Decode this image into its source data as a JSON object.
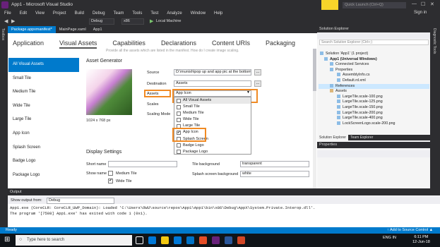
{
  "window": {
    "title": "App1 - Microsoft Visual Studio",
    "signin": "Sign in",
    "quick_launch_placeholder": "Quick Launch (Ctrl+Q)",
    "min": "—",
    "max": "☐",
    "close": "✕"
  },
  "menu": [
    "File",
    "Edit",
    "View",
    "Project",
    "Build",
    "Debug",
    "Team",
    "Tools",
    "Test",
    "Analyze",
    "Window",
    "Help"
  ],
  "toolbar": {
    "config": "Debug",
    "platform": "x86",
    "run_label": "Local Machine"
  },
  "toolbox_label": "Toolbox",
  "doc_tabs": [
    "Package.appxmanifest*",
    "MainPage.xaml",
    "App1"
  ],
  "manifest": {
    "tabs": [
      "Application",
      "Visual Assets",
      "Capabilities",
      "Declarations",
      "Content URIs",
      "Packaging"
    ],
    "hint": "Provide all the assets which are listed in the manifest. How do I create image scaling.",
    "nav": [
      "All Visual Assets",
      "Small Tile",
      "Medium Tile",
      "Wide Tile",
      "Large Tile",
      "App Icon",
      "Splash Screen",
      "Badge Logo",
      "Package Logo"
    ],
    "generator_title": "Asset Generator",
    "image_size": "1024 x 768 px",
    "source_label": "Source",
    "source_value": "D:\\munish\\pop up and app pic at the bottom",
    "destination_label": "Destination",
    "destination_value": "Assets",
    "assets_label": "Assets",
    "assets_value": "App Icon",
    "scales_label": "Scales",
    "scaling_mode_label": "Scaling Mode",
    "browse": "...",
    "dropdown": [
      {
        "label": "All Visual Assets",
        "checked": false
      },
      {
        "label": "Small Tile",
        "checked": false
      },
      {
        "label": "Medium Tile",
        "checked": false
      },
      {
        "label": "Wide Tile",
        "checked": false
      },
      {
        "label": "Large Tile",
        "checked": false
      },
      {
        "label": "App Icon",
        "checked": true
      },
      {
        "label": "Splash Screen",
        "checked": false
      },
      {
        "label": "Badge Logo",
        "checked": false
      },
      {
        "label": "Package Logo",
        "checked": false
      }
    ],
    "display_title": "Display Settings",
    "short_name_label": "Short name",
    "show_name_label": "Show name",
    "medium_tile": "Medium Tile",
    "wide_tile": "Wide Tile",
    "tile_bg_label": "Tile background",
    "tile_bg_value": "transparent",
    "splash_bg_label": "Splash screen background",
    "splash_bg_value": "white"
  },
  "solution_explorer": {
    "title": "Solution Explorer",
    "search": "Search Solution Explorer (Ctrl+;)",
    "items": [
      {
        "label": "Solution 'App1' (1 project)",
        "indent": 0,
        "bold": false,
        "selected": false
      },
      {
        "label": "App1 (Universal Windows)",
        "indent": 1,
        "bold": true,
        "selected": false
      },
      {
        "label": "Connected Services",
        "indent": 2,
        "bold": false,
        "selected": false
      },
      {
        "label": "Properties",
        "indent": 2,
        "bold": false,
        "selected": false
      },
      {
        "label": "AssemblyInfo.cs",
        "indent": 3,
        "bold": false,
        "selected": false
      },
      {
        "label": "Default.rd.xml",
        "indent": 3,
        "bold": false,
        "selected": false
      },
      {
        "label": "References",
        "indent": 2,
        "bold": false,
        "selected": true
      },
      {
        "label": "Assets",
        "indent": 2,
        "bold": false,
        "selected": false
      },
      {
        "label": "LargeTile.scale-100.png",
        "indent": 3,
        "bold": false,
        "selected": false
      },
      {
        "label": "LargeTile.scale-125.png",
        "indent": 3,
        "bold": false,
        "selected": false
      },
      {
        "label": "LargeTile.scale-150.png",
        "indent": 3,
        "bold": false,
        "selected": false
      },
      {
        "label": "LargeTile.scale-200.png",
        "indent": 3,
        "bold": false,
        "selected": false
      },
      {
        "label": "LargeTile.scale-400.png",
        "indent": 3,
        "bold": false,
        "selected": false
      },
      {
        "label": "LockScreenLogo.scale-200.png",
        "indent": 3,
        "bold": false,
        "selected": false
      }
    ],
    "bottom_tabs": [
      "Solution Explorer",
      "Team Explorer"
    ]
  },
  "properties": {
    "title": "Properties"
  },
  "right_strip_label": "Diagnostic Tools",
  "output": {
    "title": "Output",
    "show_from_label": "Show output from:",
    "show_from_value": "Debug",
    "lines": [
      "App1.exe (CoreCLR: CoreCLR_UWP_Domain): Loaded 'C:\\Users\\OWU\\source\\repos\\App1\\App1\\bin\\x86\\Debug\\AppX\\System.Private.Interop.dll'.",
      "The program '[7508] App1.exe' has exited with code 1 (0x1)."
    ]
  },
  "status": {
    "left": "Ready",
    "right": "↑ Add to Source Control ▲"
  },
  "taskbar": {
    "search": "Type here to search",
    "time": "6:11 PM",
    "date": "12-Jun-18",
    "lang": "ENG\nIN"
  }
}
